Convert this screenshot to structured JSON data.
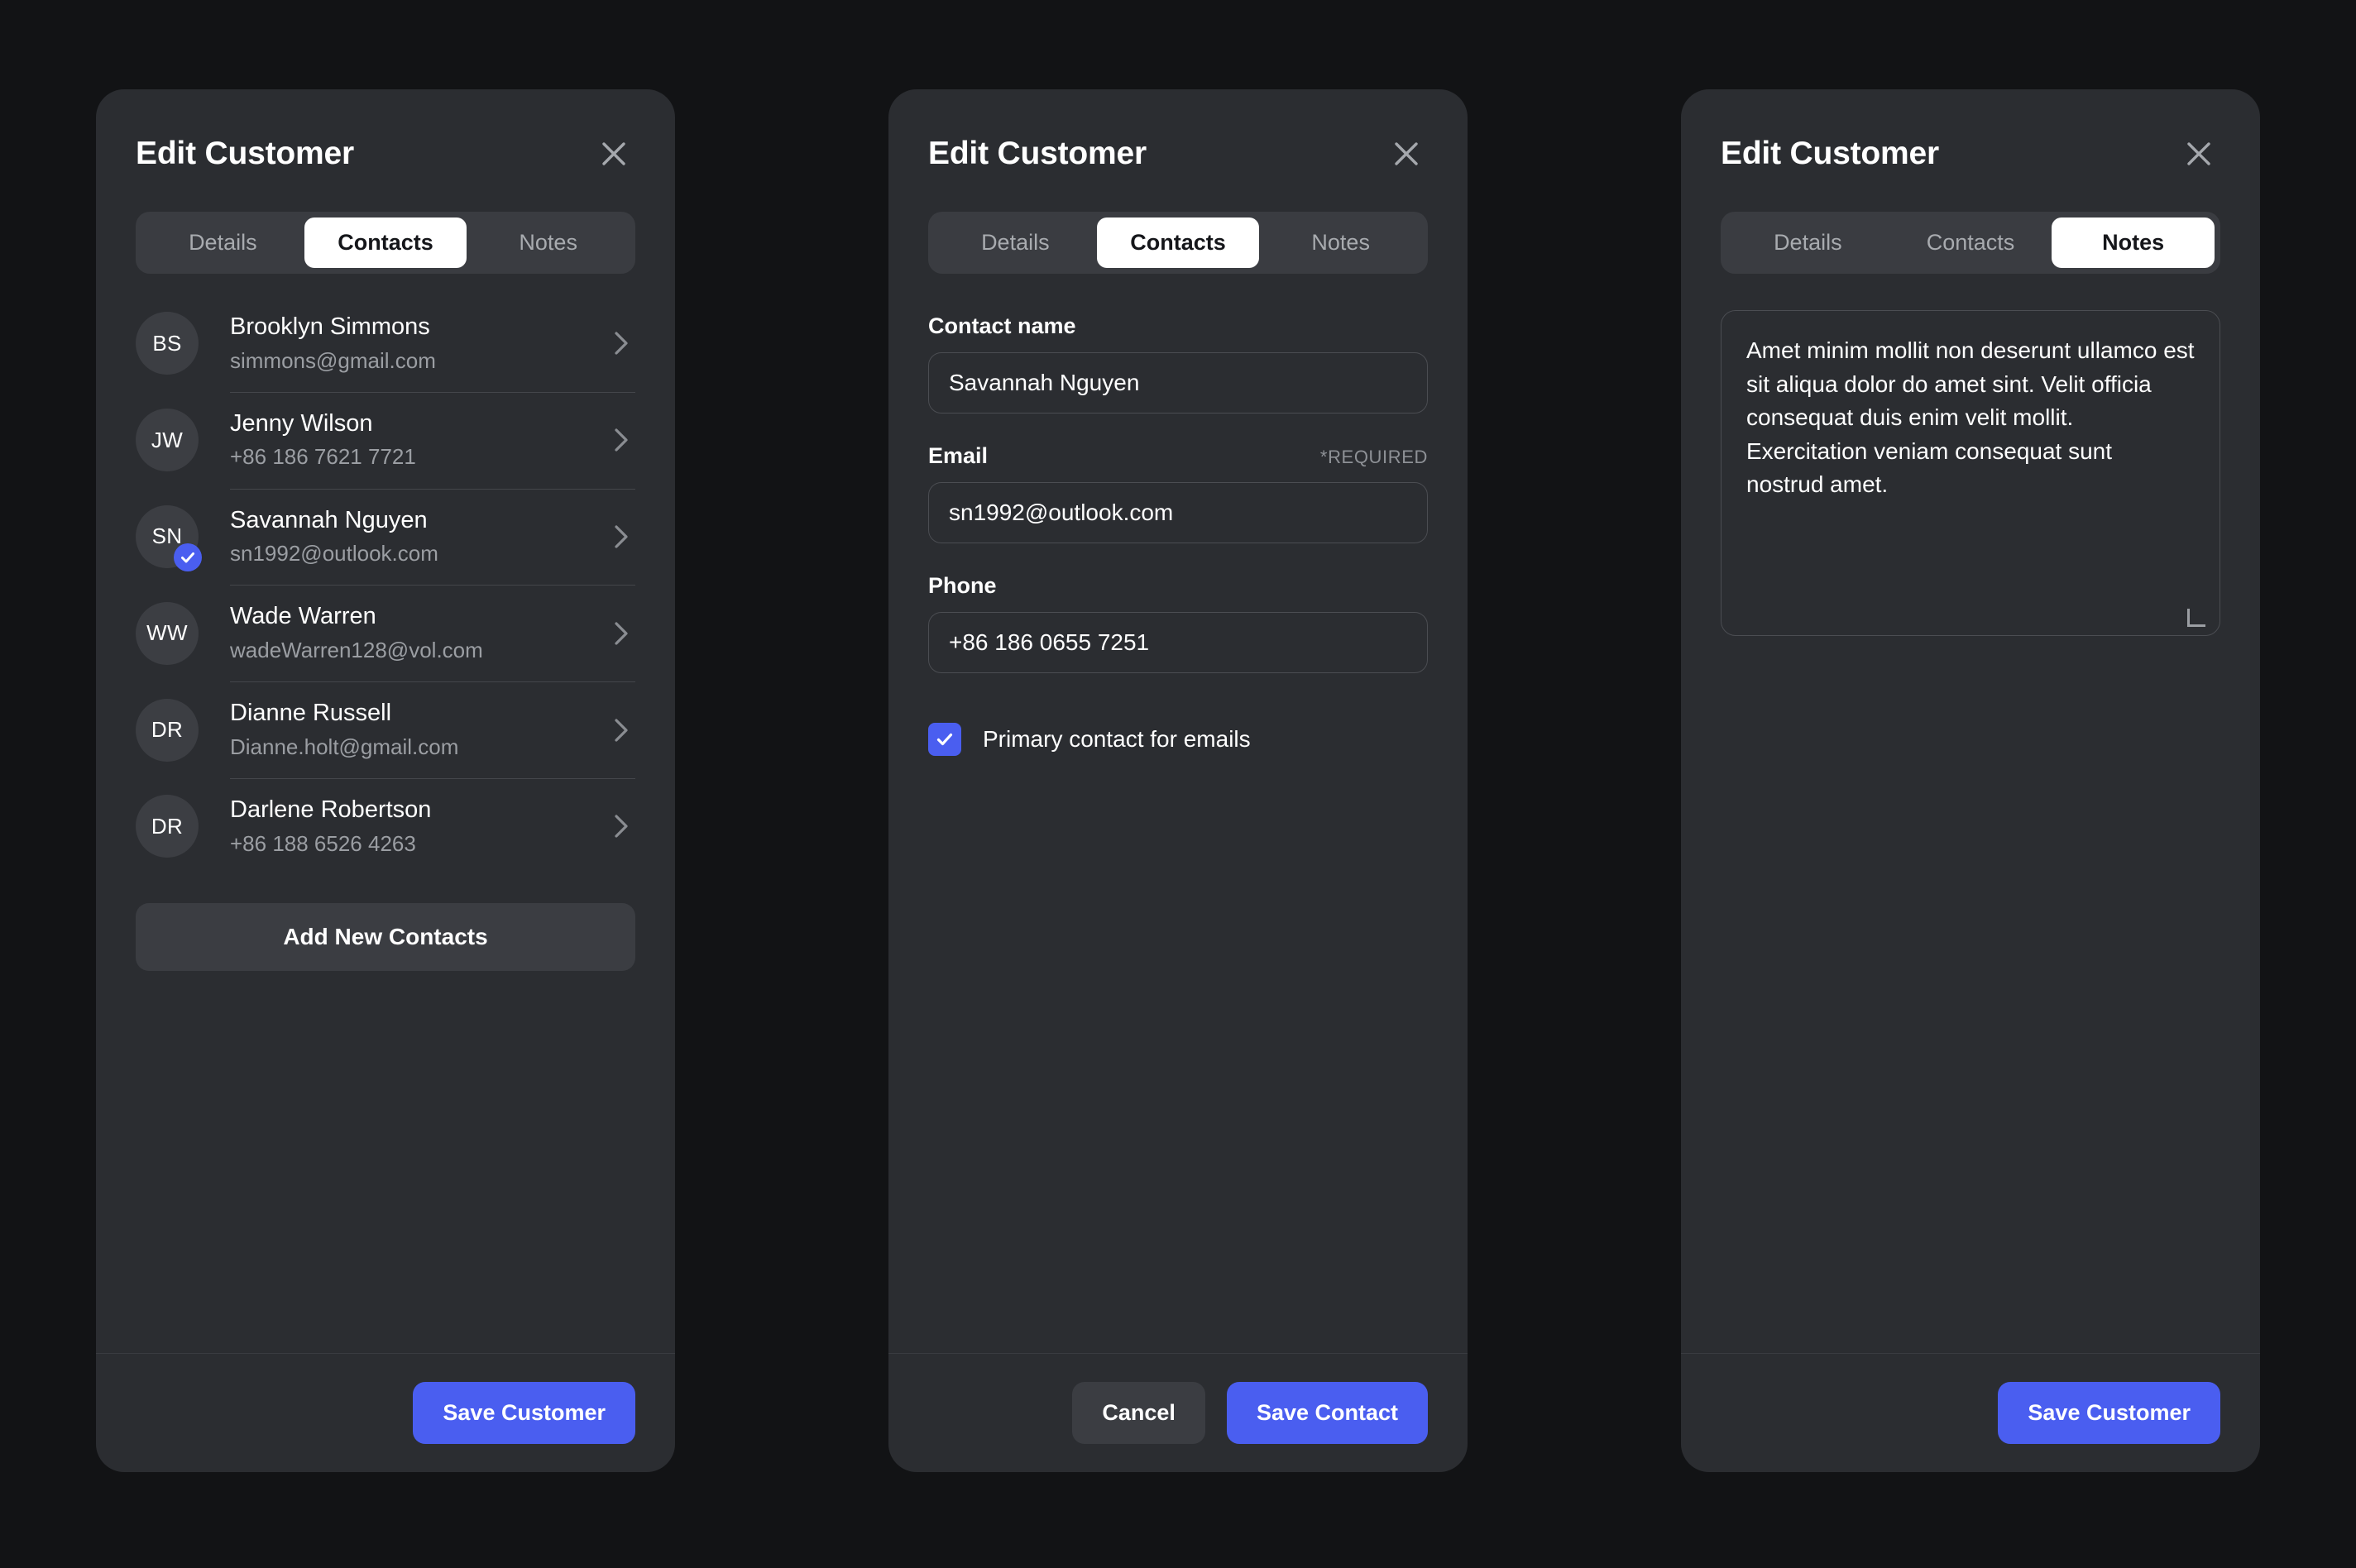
{
  "theme": {
    "page_bg": "#121315",
    "panel_bg": "#2b2d31",
    "accent": "#4a5ef0",
    "tabbar_bg": "#3a3c41",
    "muted_text": "#9b9ea3",
    "divider": "#44464b"
  },
  "panels": [
    {
      "title": "Edit Customer",
      "close_icon": "close-icon",
      "tabs": [
        {
          "label": "Details",
          "active": false
        },
        {
          "label": "Contacts",
          "active": true
        },
        {
          "label": "Notes",
          "active": false
        }
      ],
      "contacts": [
        {
          "initials": "BS",
          "name": "Brooklyn Simmons",
          "sub": "simmons@gmail.com",
          "primary": false
        },
        {
          "initials": "JW",
          "name": "Jenny Wilson",
          "sub": "+86 186 7621 7721",
          "primary": false
        },
        {
          "initials": "SN",
          "name": "Savannah Nguyen",
          "sub": "sn1992@outlook.com",
          "primary": true
        },
        {
          "initials": "WW",
          "name": "Wade Warren",
          "sub": "wadeWarren128@vol.com",
          "primary": false
        },
        {
          "initials": "DR",
          "name": "Dianne Russell",
          "sub": "Dianne.holt@gmail.com",
          "primary": false
        },
        {
          "initials": "DR",
          "name": "Darlene Robertson",
          "sub": "+86 188 6526 4263",
          "primary": false
        }
      ],
      "add_contacts_label": "Add New Contacts",
      "footer": {
        "primary_label": "Save Customer"
      }
    },
    {
      "title": "Edit Customer",
      "close_icon": "close-icon",
      "tabs": [
        {
          "label": "Details",
          "active": false
        },
        {
          "label": "Contacts",
          "active": true
        },
        {
          "label": "Notes",
          "active": false
        }
      ],
      "form": {
        "contact_name": {
          "label": "Contact name",
          "value": "Savannah Nguyen",
          "placeholder": "Contact name"
        },
        "email": {
          "label": "Email",
          "required_note": "*REQUIRED",
          "value": "sn1992@outlook.com",
          "placeholder": "Email"
        },
        "phone": {
          "label": "Phone",
          "value": "+86 186 0655 7251",
          "placeholder": "Phone"
        },
        "primary_checkbox": {
          "label": "Primary contact for emails",
          "checked": true
        }
      },
      "footer": {
        "secondary_label": "Cancel",
        "primary_label": "Save Contact"
      }
    },
    {
      "title": "Edit Customer",
      "close_icon": "close-icon",
      "tabs": [
        {
          "label": "Details",
          "active": false
        },
        {
          "label": "Contacts",
          "active": false
        },
        {
          "label": "Notes",
          "active": true
        }
      ],
      "notes": {
        "value": "Amet minim mollit non deserunt ullamco est sit aliqua dolor do amet sint. Velit officia consequat duis enim velit mollit. Exercitation veniam consequat sunt nostrud amet.",
        "placeholder": "Notes"
      },
      "footer": {
        "primary_label": "Save Customer"
      }
    }
  ]
}
